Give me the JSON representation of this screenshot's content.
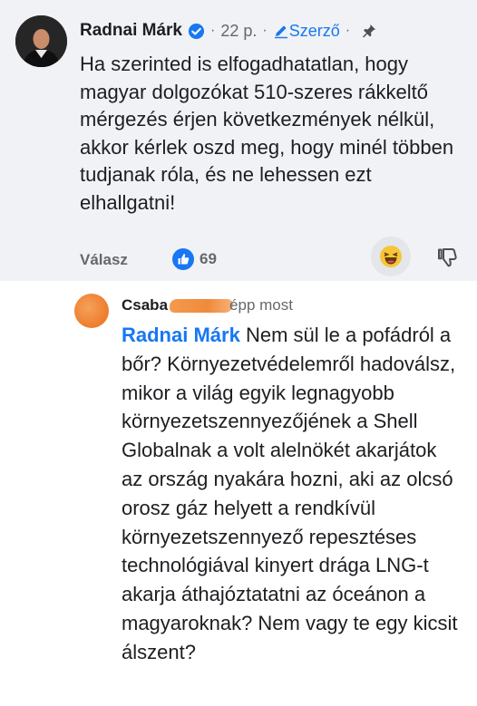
{
  "comment": {
    "author": "Radnai Márk",
    "time": "22 p.",
    "author_badge": "Szerző",
    "text": "Ha szerinted is elfogadhatatlan, hogy magyar dolgozókat 510-szeres rákkeltő mérgezés érjen következmények nélkül, akkor kérlek oszd meg, hogy minél többen tudjanak róla, és ne lehessen ezt elhallgatni!",
    "reply_label": "Válasz",
    "like_count": "69",
    "icons": [
      "verified-badge-icon",
      "pencil-icon",
      "pin-icon",
      "like-reaction-icon",
      "haha-emoji-icon",
      "dislike-icon"
    ],
    "colors": {
      "background": "#f0f2f5",
      "accent": "#1877f2",
      "meta": "#65676b"
    }
  },
  "reply": {
    "author": "Csaba",
    "time": "épp most",
    "mention": "Radnai Márk",
    "text": " Nem sül le a pofádról a bőr? Környezetvédelemről hadoválsz, mikor a világ egyik legnagyobb környezetszennyezőjének a Shell Globalnak a volt alelnökét akarjátok az ország nyakára hozni, aki az olcsó orosz gáz helyett a rendkívül környezetszennyező repesztéses technológiával kinyert drága LNG-t akarja áthajóztatatni az óceánon a magyaroknak? Nem vagy te egy kicsit álszent?",
    "colors": {
      "redaction": "#f08a3a"
    }
  }
}
